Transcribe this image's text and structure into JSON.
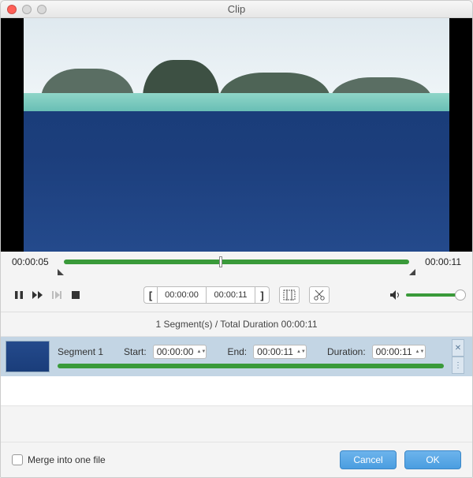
{
  "window": {
    "title": "Clip"
  },
  "timeline": {
    "current": "00:00:05",
    "total": "00:00:11",
    "in": "00:00:00",
    "out": "00:00:11"
  },
  "segments_header": "1 Segment(s) / Total Duration 00:00:11",
  "segment": {
    "name": "Segment 1",
    "start_label": "Start:",
    "start": "00:00:00",
    "end_label": "End:",
    "end": "00:00:11",
    "duration_label": "Duration:",
    "duration": "00:00:11"
  },
  "footer": {
    "merge_label": "Merge into one file",
    "cancel": "Cancel",
    "ok": "OK"
  },
  "icons": {
    "close": "close",
    "minimize": "minimize",
    "zoom": "zoom",
    "pause": "pause",
    "fast_forward": "fast-forward",
    "next_frame": "next-frame",
    "stop": "stop",
    "bracket_left": "[",
    "bracket_right": "]",
    "crop": "crop",
    "cut": "cut",
    "volume": "volume",
    "delete": "x",
    "handle": "›"
  },
  "colors": {
    "accent_green": "#3a9a3a",
    "accent_blue": "#4a9de0",
    "selection": "#c3d5e4"
  }
}
